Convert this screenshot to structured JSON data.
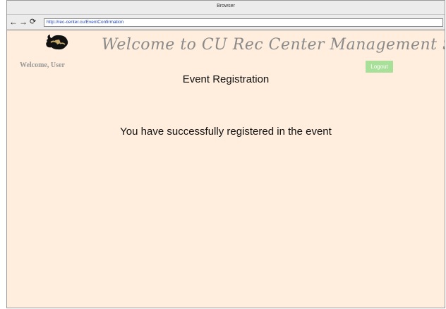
{
  "window": {
    "title": "Browser"
  },
  "nav": {
    "back_icon": "back-arrow-icon",
    "forward_icon": "forward-arrow-icon",
    "reload_icon": "reload-icon",
    "url": "http://rec-center.cu/EventConfirmation"
  },
  "header": {
    "logo": "buffalo-logo",
    "headline": "Welcome to CU Rec Center Management System",
    "welcome_text": "Welcome, User",
    "logout_label": "Logout"
  },
  "main": {
    "page_title": "Event Registration",
    "message": "You have successfully registered in the event"
  },
  "colors": {
    "page_background": "#ffeedd",
    "logout_button": "#a9e099",
    "headline_text": "#8a8a8a"
  }
}
